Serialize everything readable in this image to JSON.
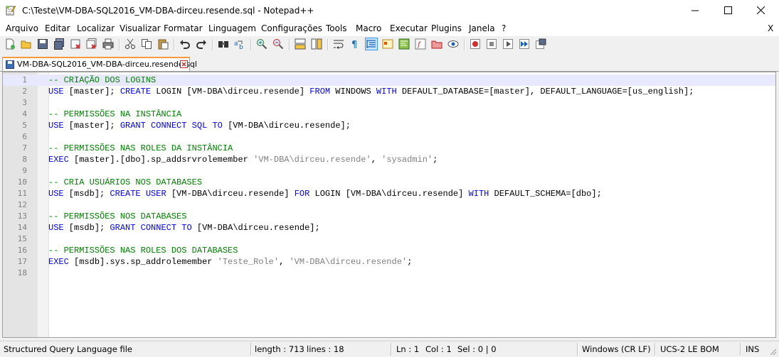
{
  "window": {
    "title": "C:\\Teste\\VM-DBA-SQL2016_VM-DBA-dirceu.resende.sql - Notepad++"
  },
  "menu": {
    "items": [
      "Arquivo",
      "Editar",
      "Localizar",
      "Visualizar",
      "Formatar",
      "Linguagem",
      "Configurações",
      "Tools",
      "Macro",
      "Executar",
      "Plugins",
      "Janela",
      "?"
    ],
    "close_label": "X"
  },
  "toolbar": {
    "icons": [
      "new-file-icon",
      "open-file-icon",
      "save-icon",
      "save-all-icon",
      "close-icon",
      "close-all-icon",
      "print-icon",
      "cut-icon",
      "copy-icon",
      "paste-icon",
      "undo-icon",
      "redo-icon",
      "find-icon",
      "replace-icon",
      "zoom-in-icon",
      "zoom-out-icon",
      "sync-vertical-icon",
      "sync-horizontal-icon",
      "word-wrap-icon",
      "show-all-characters-icon",
      "indent-guide-icon",
      "user-defined-language-icon",
      "document-map-icon",
      "function-list-icon",
      "folder-as-workspace-icon",
      "monitoring-icon",
      "record-macro-icon",
      "stop-recording-icon",
      "playback-macro-icon",
      "run-macro-multiple-icon",
      "save-macro-icon"
    ]
  },
  "tab": {
    "label": "VM-DBA-SQL2016_VM-DBA-dirceu.resende.sql"
  },
  "editor": {
    "lines": [
      {
        "n": "1",
        "tokens": [
          {
            "t": "comment",
            "v": "-- CRIAÇÃO DOS LOGINS"
          }
        ]
      },
      {
        "n": "2",
        "tokens": [
          {
            "t": "kw",
            "v": "USE"
          },
          {
            "t": "txt",
            "v": " [master]; "
          },
          {
            "t": "kw",
            "v": "CREATE"
          },
          {
            "t": "txt",
            "v": " LOGIN [VM-DBA\\dirceu.resende] "
          },
          {
            "t": "kw",
            "v": "FROM"
          },
          {
            "t": "txt",
            "v": " WINDOWS "
          },
          {
            "t": "kw",
            "v": "WITH"
          },
          {
            "t": "txt",
            "v": " DEFAULT_DATABASE=[master], DEFAULT_LANGUAGE=[us_english];"
          }
        ]
      },
      {
        "n": "3",
        "tokens": []
      },
      {
        "n": "4",
        "tokens": [
          {
            "t": "comment",
            "v": "-- PERMISSÕES NA INSTÂNCIA"
          }
        ]
      },
      {
        "n": "5",
        "tokens": [
          {
            "t": "kw",
            "v": "USE"
          },
          {
            "t": "txt",
            "v": " [master]; "
          },
          {
            "t": "kw",
            "v": "GRANT"
          },
          {
            "t": "txt",
            "v": " "
          },
          {
            "t": "kw",
            "v": "CONNECT"
          },
          {
            "t": "txt",
            "v": " "
          },
          {
            "t": "kw",
            "v": "SQL"
          },
          {
            "t": "txt",
            "v": " "
          },
          {
            "t": "kw",
            "v": "TO"
          },
          {
            "t": "txt",
            "v": " [VM-DBA\\dirceu.resende];"
          }
        ]
      },
      {
        "n": "6",
        "tokens": []
      },
      {
        "n": "7",
        "tokens": [
          {
            "t": "comment",
            "v": "-- PERMISSÕES NAS ROLES DA INSTÂNCIA"
          }
        ]
      },
      {
        "n": "8",
        "tokens": [
          {
            "t": "kw",
            "v": "EXEC"
          },
          {
            "t": "txt",
            "v": " [master].[dbo].sp_addsrvrolemember "
          },
          {
            "t": "str",
            "v": "'VM-DBA\\dirceu.resende'"
          },
          {
            "t": "txt",
            "v": ", "
          },
          {
            "t": "str",
            "v": "'sysadmin'"
          },
          {
            "t": "txt",
            "v": ";"
          }
        ]
      },
      {
        "n": "9",
        "tokens": []
      },
      {
        "n": "10",
        "tokens": [
          {
            "t": "comment",
            "v": "-- CRIA USUÁRIOS NOS DATABASES"
          }
        ]
      },
      {
        "n": "11",
        "tokens": [
          {
            "t": "kw",
            "v": "USE"
          },
          {
            "t": "txt",
            "v": " [msdb]; "
          },
          {
            "t": "kw",
            "v": "CREATE"
          },
          {
            "t": "txt",
            "v": " "
          },
          {
            "t": "kw",
            "v": "USER"
          },
          {
            "t": "txt",
            "v": " [VM-DBA\\dirceu.resende] "
          },
          {
            "t": "kw",
            "v": "FOR"
          },
          {
            "t": "txt",
            "v": " LOGIN [VM-DBA\\dirceu.resende] "
          },
          {
            "t": "kw",
            "v": "WITH"
          },
          {
            "t": "txt",
            "v": " DEFAULT_SCHEMA=[dbo];"
          }
        ]
      },
      {
        "n": "12",
        "tokens": []
      },
      {
        "n": "13",
        "tokens": [
          {
            "t": "comment",
            "v": "-- PERMISSÕES NOS DATABASES"
          }
        ]
      },
      {
        "n": "14",
        "tokens": [
          {
            "t": "kw",
            "v": "USE"
          },
          {
            "t": "txt",
            "v": " [msdb]; "
          },
          {
            "t": "kw",
            "v": "GRANT"
          },
          {
            "t": "txt",
            "v": " "
          },
          {
            "t": "kw",
            "v": "CONNECT"
          },
          {
            "t": "txt",
            "v": " "
          },
          {
            "t": "kw",
            "v": "TO"
          },
          {
            "t": "txt",
            "v": " [VM-DBA\\dirceu.resende];"
          }
        ]
      },
      {
        "n": "15",
        "tokens": []
      },
      {
        "n": "16",
        "tokens": [
          {
            "t": "comment",
            "v": "-- PERMISSÕES NAS ROLES DOS DATABASES"
          }
        ]
      },
      {
        "n": "17",
        "tokens": [
          {
            "t": "kw",
            "v": "EXEC"
          },
          {
            "t": "txt",
            "v": " [msdb].sys.sp_addrolemember "
          },
          {
            "t": "str",
            "v": "'Teste_Role'"
          },
          {
            "t": "txt",
            "v": ", "
          },
          {
            "t": "str",
            "v": "'VM-DBA\\dirceu.resende'"
          },
          {
            "t": "txt",
            "v": ";"
          }
        ]
      },
      {
        "n": "18",
        "tokens": []
      }
    ],
    "token_colors": {
      "comment": "#008000",
      "kw": "#0000ff",
      "str": "#808080",
      "txt": "#000000"
    }
  },
  "status": {
    "language": "Structured Query Language file",
    "length": "length : 713",
    "lines": "lines : 18",
    "ln": "Ln : 1",
    "col": "Col : 1",
    "sel": "Sel : 0 | 0",
    "eol": "Windows (CR LF)",
    "encoding": "UCS-2 LE BOM",
    "mode": "INS"
  },
  "colors": {
    "tab_accent": "#fa9a3c",
    "current_line": "#e8e8ff",
    "gutter": "#e4e4e4"
  }
}
